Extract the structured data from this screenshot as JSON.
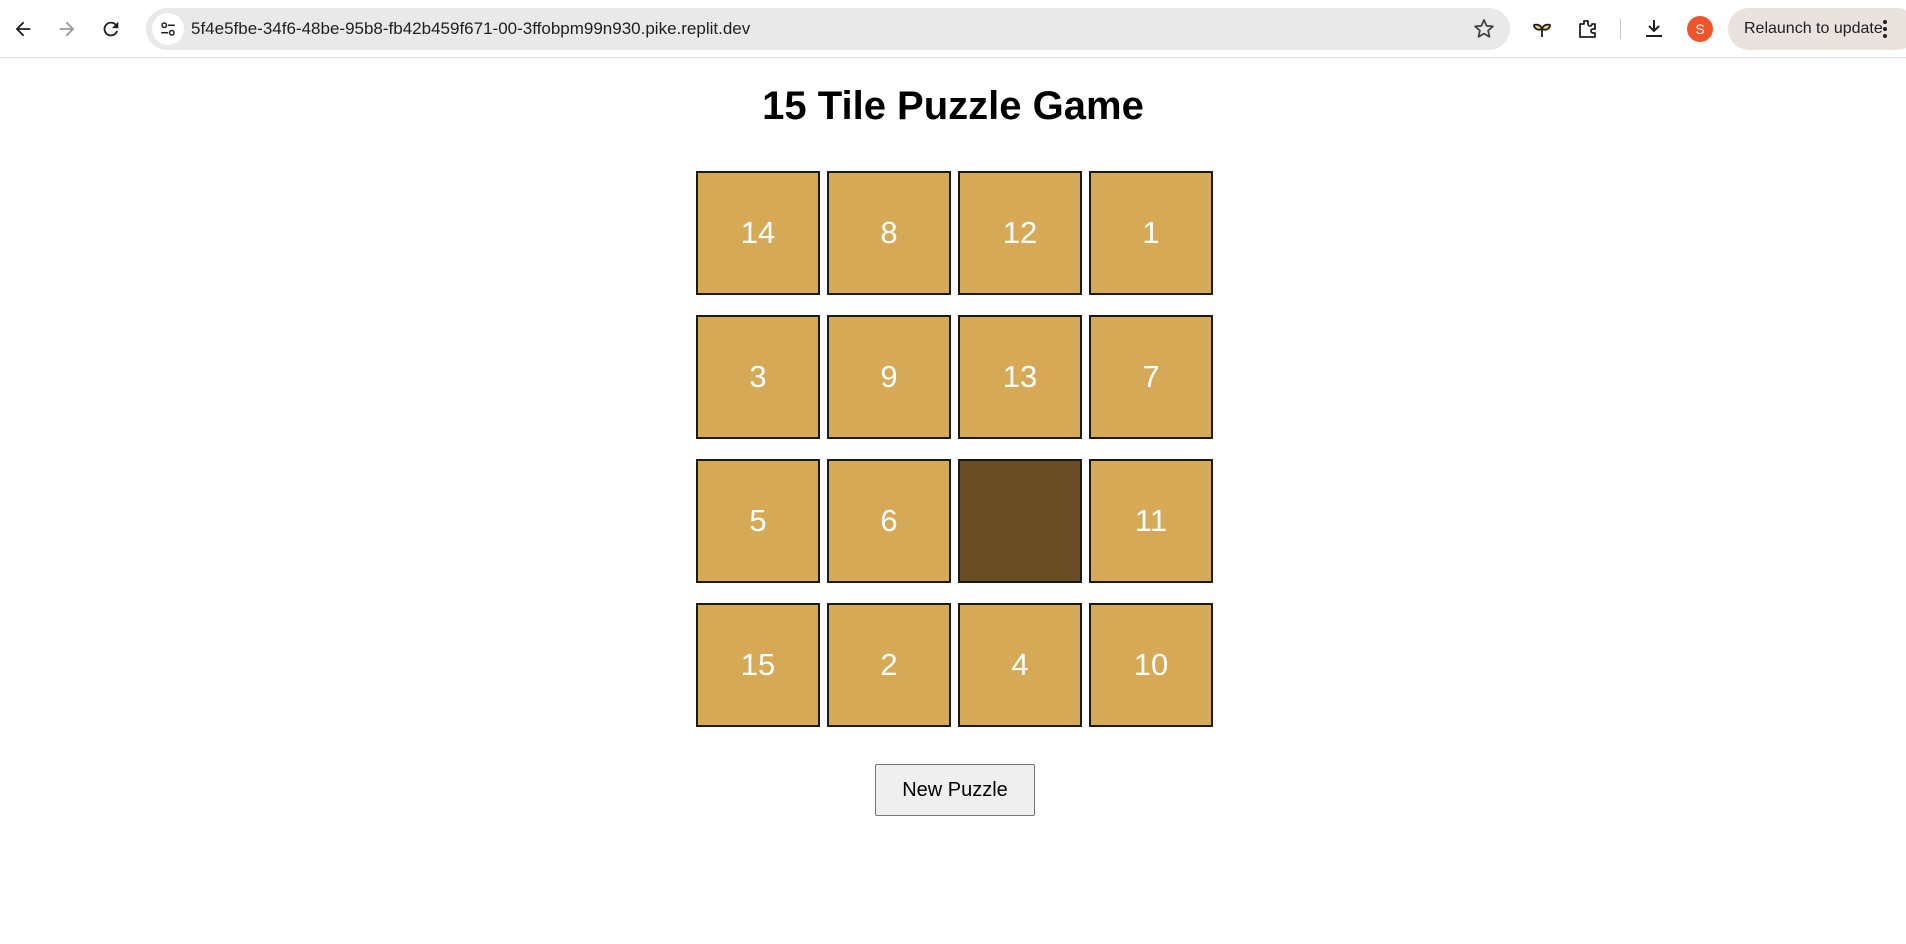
{
  "browser": {
    "url": "5f4e5fbe-34f6-48be-95b8-fb42b459f671-00-3ffobpm99n930.pike.replit.dev",
    "avatar_letter": "S",
    "relaunch_label": "Relaunch to update",
    "icons": [
      "back-icon",
      "forward-icon",
      "reload-icon",
      "site-info-icon",
      "star-icon",
      "sprout-icon",
      "extensions-icon",
      "download-icon",
      "more-icon"
    ]
  },
  "game": {
    "title": "15 Tile Puzzle Game",
    "tiles": [
      "14",
      "8",
      "12",
      "1",
      "3",
      "9",
      "13",
      "7",
      "5",
      "6",
      "",
      "11",
      "15",
      "2",
      "4",
      "10"
    ],
    "new_puzzle_label": "New Puzzle",
    "colors": {
      "tile": "#d6a956",
      "empty": "#694d24",
      "tile_text": "#ffffff"
    }
  }
}
